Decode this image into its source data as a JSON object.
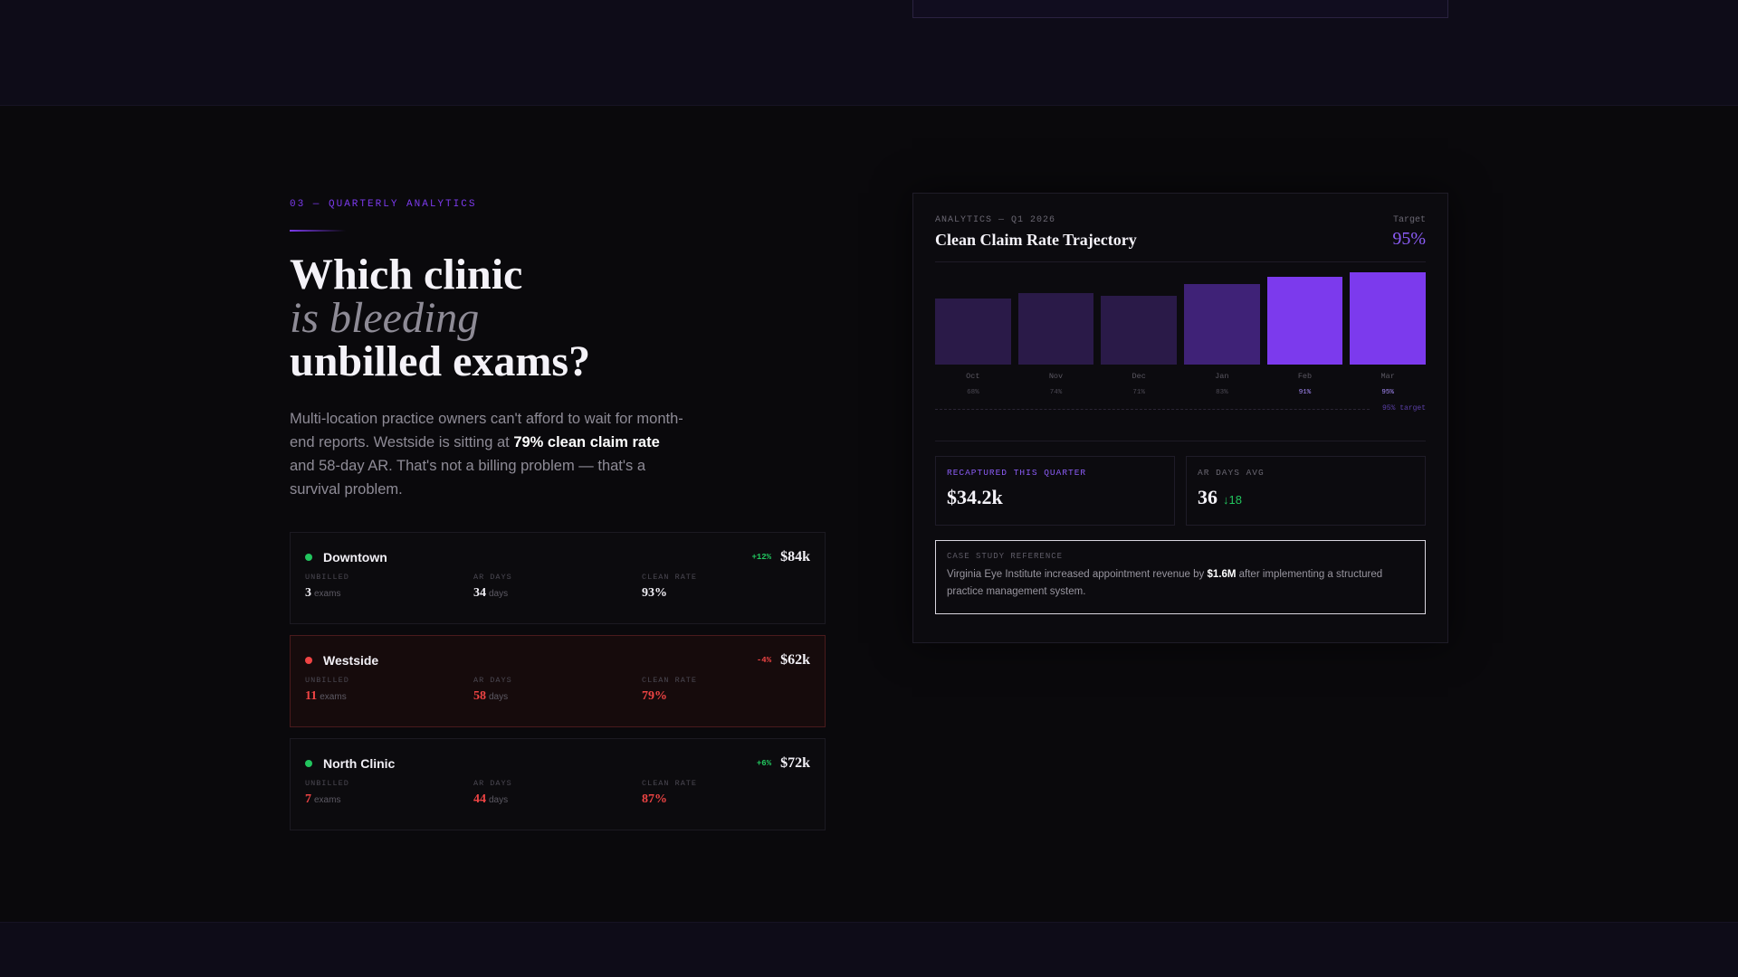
{
  "section": {
    "eyebrow": "03 — QUARTERLY ANALYTICS",
    "headline_line1": "Which clinic",
    "headline_line2": "is bleeding",
    "headline_line3": "unbilled exams?",
    "lede_part1": "Multi-location practice owners can't afford to wait for month-end reports. Westside is sitting at ",
    "lede_bold": "79% clean claim rate",
    "lede_part2": " and 58-day AR. That's not a billing problem — that's a survival problem."
  },
  "metric_labels": {
    "unbilled": "UNBILLED",
    "ar_days": "AR DAYS",
    "clean_rate": "CLEAN RATE"
  },
  "clinics": [
    {
      "name": "Downtown",
      "status": "good",
      "delta": "+12%",
      "revenue": "$84k",
      "unbilled": "3",
      "unbilled_unit": "exams",
      "ar_days": "34",
      "ar_unit": "days",
      "clean_rate": "93%"
    },
    {
      "name": "Westside",
      "status": "bad",
      "delta": "-4%",
      "revenue": "$62k",
      "unbilled": "11",
      "unbilled_unit": "exams",
      "ar_days": "58",
      "ar_unit": "days",
      "clean_rate": "79%"
    },
    {
      "name": "North Clinic",
      "status": "good",
      "delta": "+6%",
      "revenue": "$72k",
      "unbilled": "7",
      "unbilled_unit": "exams",
      "ar_days": "44",
      "ar_unit": "days",
      "clean_rate": "87%"
    }
  ],
  "card": {
    "eyebrow": "ANALYTICS — Q1 2026",
    "title": "Clean Claim Rate Trajectory",
    "target_label": "Target",
    "target_value": "95%",
    "target_line_label": "95% target"
  },
  "chart_data": {
    "type": "bar",
    "categories": [
      "Oct",
      "Nov",
      "Dec",
      "Jan",
      "Feb",
      "Mar"
    ],
    "values": [
      68,
      74,
      71,
      83,
      91,
      95
    ],
    "value_labels": [
      "68%",
      "74%",
      "71%",
      "83%",
      "91%",
      "95%"
    ],
    "ylim": [
      0,
      100
    ],
    "target": 95,
    "colors": [
      "#2a1a48",
      "#2a1a48",
      "#2a1a48",
      "#3f2277",
      "#7c3aed",
      "#7c3aed"
    ],
    "grid": false
  },
  "stats": {
    "recaptured_label": "RECAPTURED THIS QUARTER",
    "recaptured_value": "$34.2k",
    "ar_label": "AR DAYS AVG",
    "ar_value": "36",
    "ar_delta": "↓18"
  },
  "case_study": {
    "label": "CASE STUDY REFERENCE",
    "text_part1": "Virginia Eye Institute increased appointment revenue by ",
    "text_bold": "$1.6M",
    "text_part2": " after implementing a structured practice management system."
  },
  "colors": {
    "accent": "#7c3aed",
    "good": "#22c55e",
    "bad": "#ef4444"
  }
}
